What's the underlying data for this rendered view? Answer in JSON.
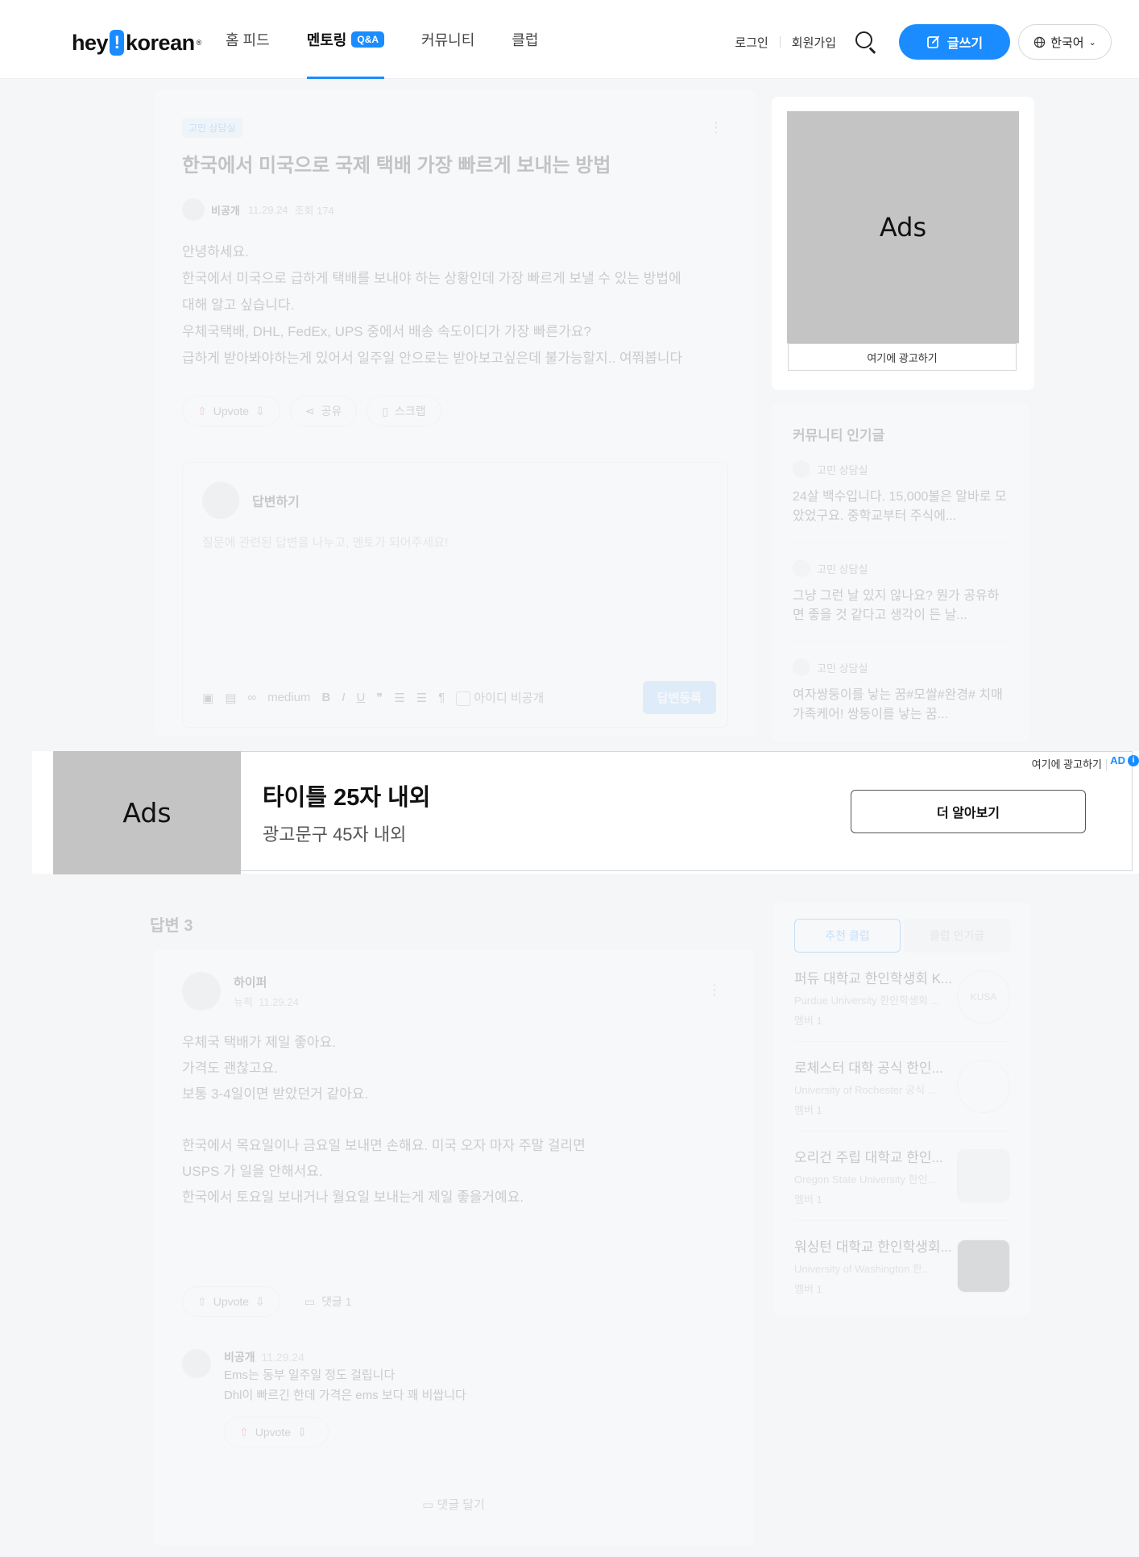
{
  "header": {
    "logo_left": "hey",
    "logo_mark": "!",
    "logo_right": "korean",
    "logo_reg": "®",
    "nav": [
      {
        "label": "홈 피드"
      },
      {
        "label": "멘토링",
        "badge": "Q&A"
      },
      {
        "label": "커뮤니티"
      },
      {
        "label": "클럽"
      }
    ],
    "login": "로그인",
    "signup": "회원가입",
    "write": "글쓰기",
    "language": "한국어",
    "accent": "#1a8cff"
  },
  "question": {
    "tag": "고민 상담실",
    "title": "한국에서 미국으로 국제 택배 가장 빠르게 보내는 방법",
    "author": "비공개",
    "date": "11.29.24",
    "views": "조회 174",
    "body": [
      "안녕하세요.",
      "한국에서 미국으로 급하게 택배를 보내야 하는 상황인데 가장 빠르게 보낼 수 있는 방법에",
      "대해 알고 싶습니다.",
      "우체국택배, DHL, FedEx, UPS 중에서 배송 속도이디가 가장 빠른가요?",
      "급하게 받아봐야하는게 있어서 일주일 안으로는 받아보고싶은데 불가능할지.. 여쭤봅니다"
    ],
    "upvote": "Upvote",
    "share": "공유",
    "scrap": "스크랩"
  },
  "answer_form": {
    "title": "답변하기",
    "placeholder": "질문에 관련된 답변을 나누고, 멘토가 되어주세요!",
    "size": "medium",
    "anonymous": "아이디 비공개",
    "submit": "답변등록"
  },
  "side_ad": {
    "label": "Ads",
    "caption": "여기에 광고하기"
  },
  "popular": {
    "title": "커뮤니티 인기글",
    "items": [
      {
        "category": "고민 상담실",
        "text": "24살 백수입니다. 15,000불은 알바로 모았었구요. 중학교부터 주식에..."
      },
      {
        "category": "고민 상담실",
        "text": "그냥 그런 날 있지 않나요? 뭔가 공유하면 좋을 것 같다고 생각이 든 날..."
      },
      {
        "category": "고민 상담실",
        "text": "여자쌍둥이를 낳는 꿈#모쌀#완경# 치매가족케어! 쌍둥이를 낳는 꿈..."
      }
    ]
  },
  "banner_ad": {
    "image_label": "Ads",
    "title": "타이틀 25자 내외",
    "desc": "광고문구 45자 내외",
    "cta": "더 알아보기",
    "advertise": "여기에 광고하기",
    "ad_badge": "AD"
  },
  "answers": {
    "count_label": "답변 3",
    "first": {
      "author": "하이퍼",
      "level": "뉴픽",
      "date": "11.29.24",
      "body": [
        "우체국 택배가 제일 좋아요.",
        "가격도 괜찮고요.",
        "보통 3-4일이면 받았던거 같아요.",
        "",
        "한국에서 목요일이나 금요일 보내면 손해요. 미국 오자 마자 주말 걸리면",
        "USPS 가 일을 안해서요.",
        "한국에서 토요일 보내거나 월요일 보내는게 제일 좋을거예요."
      ],
      "upvote": "Upvote",
      "comments": "댓글 1"
    },
    "comment": {
      "author": "비공개",
      "date": "11.29.24",
      "lines": [
        "Ems는 동부 일주일 정도 걸립니다",
        "Dhl이 빠르긴 한데 가격은 ems 보다 꽤 비쌉니다"
      ],
      "upvote": "Upvote"
    },
    "add_comment": "댓글 달기"
  },
  "clubs": {
    "tab_recommend": "추천 클럽",
    "tab_popular": "클럽 인기글",
    "items": [
      {
        "name": "퍼듀 대학교 한인학생회 K...",
        "uni": "Purdue University 한인학생회 ...",
        "members": "멤버 1",
        "logo": "KUSA"
      },
      {
        "name": "로체스터 대학 공식 한인...",
        "uni": "University of Rochester 공식 ...",
        "members": "멤버 1",
        "logo": ""
      },
      {
        "name": "오리건 주립 대학교 한인...",
        "uni": "Oregon State University 한인...",
        "members": "멤버 1",
        "logo": ""
      },
      {
        "name": "워싱턴 대학교 한인학생회...",
        "uni": "University of Washington 한...",
        "members": "멤버 1",
        "logo": ""
      }
    ]
  }
}
